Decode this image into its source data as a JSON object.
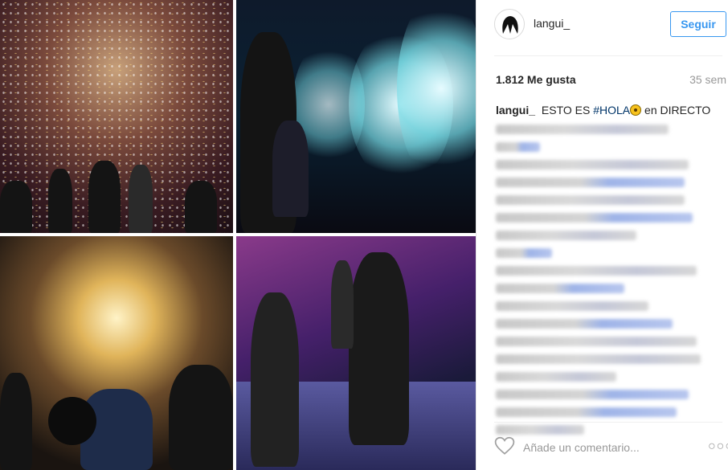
{
  "post": {
    "username": "langui_",
    "follow_label": "Seguir",
    "likes": "1.812 Me gusta",
    "age": "35 sem",
    "caption": {
      "username": "langui_",
      "text_before": "ESTO ES",
      "hashtag": "#HOLA",
      "text_after": "en DIRECTO"
    },
    "add_comment_placeholder": "Añade un comentario...",
    "more_label": "○○○"
  },
  "icons": {
    "heart": "heart-outline-icon",
    "more": "more-options-icon"
  },
  "colors": {
    "accent": "#3897f0",
    "hashtag": "#003569"
  }
}
